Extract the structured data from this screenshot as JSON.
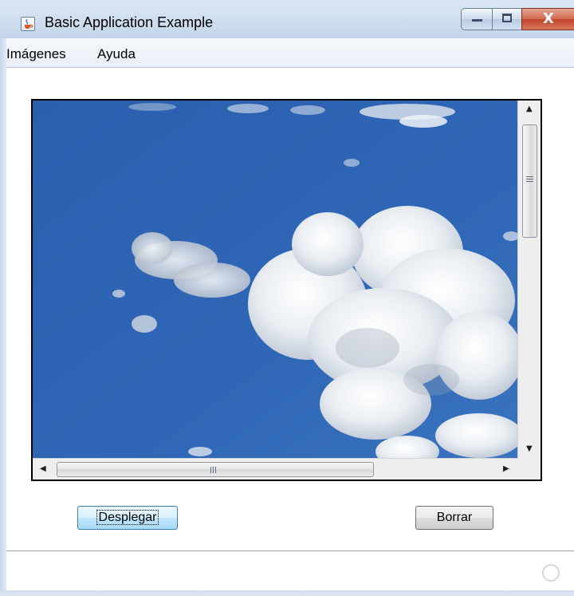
{
  "window": {
    "title": "Basic Application Example",
    "controls": {
      "minimize": "minimize-icon",
      "maximize": "maximize-icon",
      "close": "close-icon",
      "close_glyph": "X"
    },
    "app_icon": "java-cup-icon"
  },
  "menubar": {
    "items": [
      {
        "label": "Imágenes"
      },
      {
        "label": "Ayuda"
      }
    ]
  },
  "viewer": {
    "content": "sky-with-clouds-image",
    "vertical_scroll": {
      "up_glyph": "▲",
      "down_glyph": "▼",
      "grip": "|||"
    },
    "horizontal_scroll": {
      "left_glyph": "◀",
      "right_glyph": "▶",
      "grip": "III"
    }
  },
  "buttons": {
    "display_label": "Desplegar",
    "clear_label": "Borrar"
  },
  "colors": {
    "sky": "#2e64b0",
    "frame": "#c6d6ea"
  }
}
